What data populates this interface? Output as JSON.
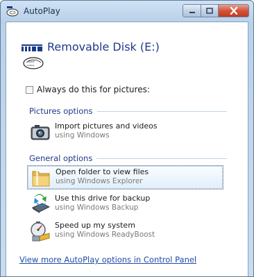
{
  "window": {
    "title": "AutoPlay",
    "controls": {
      "minimize_icon": "minimize-icon",
      "maximize_icon": "maximize-icon",
      "close_icon": "close-icon"
    }
  },
  "device": {
    "logo_text": "INOR",
    "title": "Removable Disk (E:)"
  },
  "always_option": {
    "label": "Always do this for pictures:",
    "checked": false
  },
  "sections": {
    "pictures": {
      "heading": "Pictures options",
      "items": [
        {
          "title": "Import pictures and videos",
          "subtitle": "using Windows",
          "icon": "camera-icon"
        }
      ]
    },
    "general": {
      "heading": "General options",
      "items": [
        {
          "title": "Open folder to view files",
          "subtitle": "using Windows Explorer",
          "icon": "folder-icon",
          "selected": true
        },
        {
          "title": "Use this drive for backup",
          "subtitle": "using Windows Backup",
          "icon": "backup-icon"
        },
        {
          "title": "Speed up my system",
          "subtitle": "using Windows ReadyBoost",
          "icon": "readyboost-icon"
        }
      ]
    }
  },
  "footer": {
    "link": "View more AutoPlay options in Control Panel"
  },
  "colors": {
    "accent": "#1e3a8a",
    "link": "#1f4aa8",
    "close_button": "#c23a21"
  }
}
